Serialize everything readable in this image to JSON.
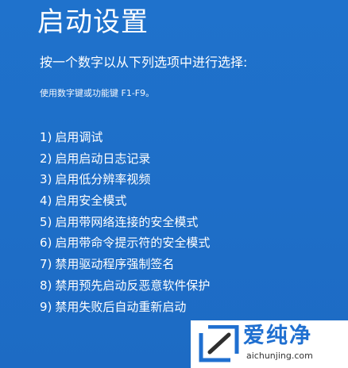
{
  "title": "启动设置",
  "prompt": "按一个数字以从下列选项中进行选择:",
  "hint": "使用数字键或功能键 F1-F9。",
  "options": [
    {
      "num": "1)",
      "label": "启用调试"
    },
    {
      "num": "2)",
      "label": "启用启动日志记录"
    },
    {
      "num": "3)",
      "label": "启用低分辨率视频"
    },
    {
      "num": "4)",
      "label": "启用安全模式"
    },
    {
      "num": "5)",
      "label": "启用带网络连接的安全模式"
    },
    {
      "num": "6)",
      "label": "启用带命令提示符的安全模式"
    },
    {
      "num": "7)",
      "label": "禁用驱动程序强制签名"
    },
    {
      "num": "8)",
      "label": "禁用预先启动反恶意软件保护"
    },
    {
      "num": "9)",
      "label": "禁用失败后自动重新启动"
    }
  ],
  "watermark": {
    "name": "爱纯净",
    "url": "aichunjing.com",
    "icon": "aichunjing-logo-icon"
  },
  "colors": {
    "background": "#1e6fc8",
    "text": "#ffffff",
    "watermark_brand": "#1f6fd0"
  }
}
